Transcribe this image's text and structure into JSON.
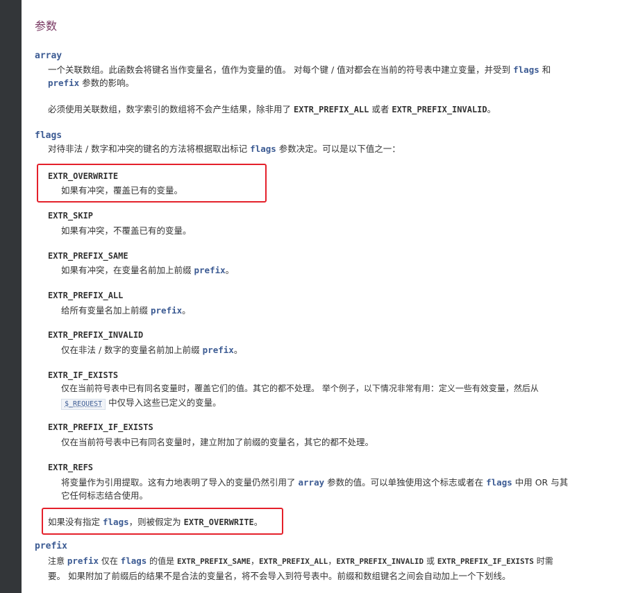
{
  "section_title": "参数",
  "array": {
    "term": "array",
    "p1_a": "一个关联数组。此函数会将键名当作变量名，值作为变量的值。 对每个键 / 值对都会在当前的符号表中建立变量，并受到",
    "p1_flags": "flags",
    "p1_b": "和",
    "p1_prefix": "prefix",
    "p1_c": "参数的影响。",
    "p2_a": "必须使用关联数组，数字索引的数组将不会产生结果，除非用了",
    "p2_const1": "EXTR_PREFIX_ALL",
    "p2_b": "或者",
    "p2_const2": "EXTR_PREFIX_INVALID",
    "p2_c": "。"
  },
  "flags": {
    "term": "flags",
    "intro_a": "对待非法 / 数字和冲突的键名的方法将根据取出标记",
    "intro_code": "flags",
    "intro_b": "参数决定。可以是以下值之一：",
    "items": [
      {
        "name": "EXTR_OVERWRITE",
        "desc": "如果有冲突，覆盖已有的变量。"
      },
      {
        "name": "EXTR_SKIP",
        "desc": "如果有冲突，不覆盖已有的变量。"
      },
      {
        "name": "EXTR_PREFIX_SAME",
        "desc_a": "如果有冲突，在变量名前加上前缀",
        "code": "prefix",
        "desc_b": "。"
      },
      {
        "name": "EXTR_PREFIX_ALL",
        "desc_a": "给所有变量名加上前缀",
        "code": "prefix",
        "desc_b": "。"
      },
      {
        "name": "EXTR_PREFIX_INVALID",
        "desc_a": "仅在非法 / 数字的变量名前加上前缀",
        "code": "prefix",
        "desc_b": "。"
      },
      {
        "name": "EXTR_IF_EXISTS",
        "desc_a": "仅在当前符号表中已有同名变量时，覆盖它们的值。其它的都不处理。 举个例子，以下情况非常有用：定义一些有效变量，然后从",
        "req": "$_REQUEST",
        "desc_b": "中仅导入这些已定义的变量。"
      },
      {
        "name": "EXTR_PREFIX_IF_EXISTS",
        "desc": "仅在当前符号表中已有同名变量时，建立附加了前缀的变量名，其它的都不处理。"
      },
      {
        "name": "EXTR_REFS",
        "desc_a": "将变量作为引用提取。这有力地表明了导入的变量仍然引用了",
        "code1": "array",
        "desc_b": "参数的值。可以单独使用这个标志或者在",
        "code2": "flags",
        "desc_c": "中用 OR 与其",
        "desc_d": "它任何标志结合使用。"
      }
    ],
    "default_a": "如果没有指定",
    "default_code": "flags",
    "default_b": "，则被假定为",
    "default_const": "EXTR_OVERWRITE",
    "default_c": "。"
  },
  "prefix": {
    "term": "prefix",
    "p_a": "注意",
    "p_code1": "prefix",
    "p_b": "仅在",
    "p_code2": "flags",
    "p_c": "的值是",
    "p_const1": "EXTR_PREFIX_SAME",
    "p_sep1": "，",
    "p_const2": "EXTR_PREFIX_ALL",
    "p_sep2": "，",
    "p_const3": "EXTR_PREFIX_INVALID",
    "p_d": "或",
    "p_const4": "EXTR_PREFIX_IF_EXISTS",
    "p_e": "时需",
    "p_line2": "要。 如果附加了前缀后的结果不是合法的变量名，将不会导入到符号表中。前缀和数组键名之间会自动加上一个下划线。"
  }
}
